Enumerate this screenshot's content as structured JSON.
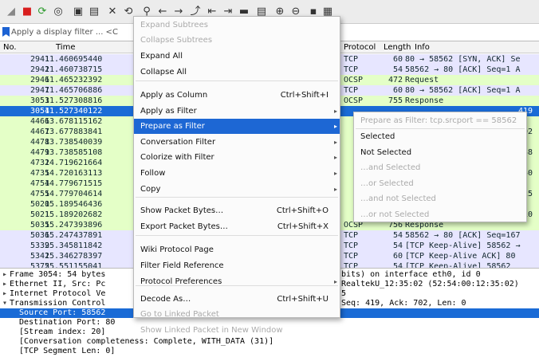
{
  "toolbar": {
    "icons": [
      "shark-fin-icon",
      "stop-icon",
      "restart-icon",
      "options-gear-icon",
      "open-file-icon",
      "save-file-icon",
      "close-file-icon",
      "reload-icon",
      "find-icon",
      "go-back-icon",
      "go-forward-icon",
      "go-to-packet-icon",
      "first-packet-icon",
      "last-packet-icon",
      "autoscroll-icon",
      "colorize-icon",
      "zoom-in-icon",
      "zoom-out-icon",
      "normal-size-icon",
      "resize-columns-icon"
    ]
  },
  "filter": {
    "placeholder": "Apply a display filter ... <C"
  },
  "columns": {
    "no": "No.",
    "time": "Time",
    "protocol": "Protocol",
    "length": "Length",
    "info": "Info"
  },
  "packets": [
    {
      "no": "2941",
      "time": "11.460695440",
      "protocol": "TCP",
      "length": "60",
      "info": "80 → 58562 [SYN, ACK] Se",
      "color": "#e7e6ff"
    },
    {
      "no": "2942",
      "time": "11.460738715",
      "protocol": "TCP",
      "length": "54",
      "info": "58562 → 80 [ACK] Seq=1 A",
      "color": "#e7e6ff"
    },
    {
      "no": "2946",
      "time": "11.465232392",
      "protocol": "OCSP",
      "length": "472",
      "info": "Request",
      "color": "#e4ffc7"
    },
    {
      "no": "2947",
      "time": "11.465706886",
      "protocol": "TCP",
      "length": "60",
      "info": "80 → 58562 [ACK] Seq=1 A",
      "color": "#e7e6ff"
    },
    {
      "no": "3053",
      "time": "11.527308816",
      "protocol": "OCSP",
      "length": "755",
      "info": "Response",
      "color": "#e4ffc7"
    },
    {
      "no": "3054",
      "time": "11.527340122",
      "protocol": "",
      "length": "",
      "info": "419",
      "color": "#1a6bd6",
      "selected": true
    },
    {
      "no": "4466",
      "time": "13.678115162",
      "protocol": "",
      "length": "",
      "info": "",
      "color": "#e4ffc7"
    },
    {
      "no": "4467",
      "time": "13.677883841",
      "protocol": "",
      "length": "",
      "info": "702",
      "color": "#e4ffc7"
    },
    {
      "no": "4478",
      "time": "13.738540039",
      "protocol": "",
      "length": "",
      "info": "",
      "color": "#e4ffc7"
    },
    {
      "no": "4479",
      "time": "13.738585108",
      "protocol": "",
      "length": "",
      "info": "838",
      "color": "#e4ffc7"
    },
    {
      "no": "4732",
      "time": "14.719621664",
      "protocol": "",
      "length": "",
      "info": "",
      "color": "#e4ffc7"
    },
    {
      "no": "4735",
      "time": "14.720163113",
      "protocol": "",
      "length": "",
      "info": "140",
      "color": "#e4ffc7"
    },
    {
      "no": "4754",
      "time": "14.779671515",
      "protocol": "",
      "length": "",
      "info": "",
      "color": "#e4ffc7"
    },
    {
      "no": "4755",
      "time": "14.779704614",
      "protocol": "",
      "length": "",
      "info": "125",
      "color": "#e4ffc7"
    },
    {
      "no": "5020",
      "time": "15.189546436",
      "protocol": "",
      "length": "",
      "info": "",
      "color": "#e4ffc7"
    },
    {
      "no": "5021",
      "time": "15.189202682",
      "protocol": "",
      "length": "",
      "info": "210",
      "color": "#e4ffc7"
    },
    {
      "no": "5035",
      "time": "15.247393896",
      "protocol": "OCSP",
      "length": "756",
      "info": "Response",
      "color": "#e4ffc7"
    },
    {
      "no": "5036",
      "time": "15.247437891",
      "protocol": "TCP",
      "length": "54",
      "info": "58562 → 80 [ACK] Seq=167",
      "color": "#e7e6ff"
    },
    {
      "no": "5339",
      "time": "25.345811842",
      "protocol": "TCP",
      "length": "54",
      "info": "[TCP Keep-Alive] 58562 →",
      "color": "#e7e6ff"
    },
    {
      "no": "5341",
      "time": "25.346278397",
      "protocol": "TCP",
      "length": "60",
      "info": "[TCP Keep-Alive ACK] 80",
      "color": "#e7e6ff"
    },
    {
      "no": "5375",
      "time": "25.551155041",
      "protocol": "TCP",
      "length": "54",
      "info": "[TCP Keep-Alive] 58562",
      "color": "#e7e6ff"
    }
  ],
  "details": [
    {
      "arrow": "▸",
      "text": "Frame 3054: 54 bytes",
      "right": "bits) on interface eth0, id 0"
    },
    {
      "arrow": "▸",
      "text": "Ethernet II, Src: Pc",
      "right": "RealtekU_12:35:02 (52:54:00:12:35:02)"
    },
    {
      "arrow": "▸",
      "text": "Internet Protocol Ve",
      "right": "5"
    },
    {
      "arrow": "▾",
      "text": "Transmission Control",
      "right": "Seq: 419, Ack: 702, Len: 0"
    },
    {
      "arrow": "",
      "text": "  Source Port: 58562",
      "right": "",
      "selected": true
    },
    {
      "arrow": "",
      "text": "  Destination Port: 80",
      "right": ""
    },
    {
      "arrow": "",
      "text": "  [Stream index: 20]",
      "right": ""
    },
    {
      "arrow": "",
      "text": "  [Conversation completeness: Complete, WITH_DATA (31)]",
      "right": ""
    },
    {
      "arrow": "",
      "text": "  [TCP Segment Len: 0]",
      "right": ""
    }
  ],
  "context_menu": {
    "items": [
      {
        "label": "Expand Subtrees",
        "shortcut": "",
        "submenu": false,
        "disabled": true
      },
      {
        "label": "Collapse Subtrees",
        "shortcut": "",
        "submenu": false,
        "disabled": true
      },
      {
        "label": "Expand All",
        "shortcut": "",
        "submenu": false,
        "disabled": false
      },
      {
        "label": "Collapse All",
        "shortcut": "",
        "submenu": false,
        "disabled": false
      },
      {
        "label": "Apply as Column",
        "shortcut": "Ctrl+Shift+I",
        "submenu": false,
        "disabled": false
      },
      {
        "label": "Apply as Filter",
        "shortcut": "",
        "submenu": true,
        "disabled": false
      },
      {
        "label": "Prepare as Filter",
        "shortcut": "",
        "submenu": true,
        "disabled": false,
        "highlighted": true
      },
      {
        "label": "Conversation Filter",
        "shortcut": "",
        "submenu": true,
        "disabled": false
      },
      {
        "label": "Colorize with Filter",
        "shortcut": "",
        "submenu": true,
        "disabled": false
      },
      {
        "label": "Follow",
        "shortcut": "",
        "submenu": true,
        "disabled": false
      },
      {
        "label": "Copy",
        "shortcut": "",
        "submenu": true,
        "disabled": false
      },
      {
        "label": "Show Packet Bytes…",
        "shortcut": "Ctrl+Shift+O",
        "submenu": false,
        "disabled": false
      },
      {
        "label": "Export Packet Bytes…",
        "shortcut": "Ctrl+Shift+X",
        "submenu": false,
        "disabled": false
      },
      {
        "label": "Wiki Protocol Page",
        "shortcut": "",
        "submenu": false,
        "disabled": false
      },
      {
        "label": "Filter Field Reference",
        "shortcut": "",
        "submenu": false,
        "disabled": false
      },
      {
        "label": "Protocol Preferences",
        "shortcut": "",
        "submenu": true,
        "disabled": false
      },
      {
        "label": "Decode As…",
        "shortcut": "Ctrl+Shift+U",
        "submenu": false,
        "disabled": false
      },
      {
        "label": "Go to Linked Packet",
        "shortcut": "",
        "submenu": false,
        "disabled": true
      },
      {
        "label": "Show Linked Packet in New Window",
        "shortcut": "",
        "submenu": false,
        "disabled": true
      }
    ]
  },
  "submenu": {
    "items": [
      {
        "label": "Prepare as Filter: tcp.srcport == 58562",
        "disabled": true
      },
      {
        "label": "Selected",
        "disabled": false
      },
      {
        "label": "Not Selected",
        "disabled": false
      },
      {
        "label": "…and Selected",
        "disabled": true
      },
      {
        "label": "…or Selected",
        "disabled": true
      },
      {
        "label": "…and not Selected",
        "disabled": true
      },
      {
        "label": "…or not Selected",
        "disabled": true
      }
    ]
  }
}
